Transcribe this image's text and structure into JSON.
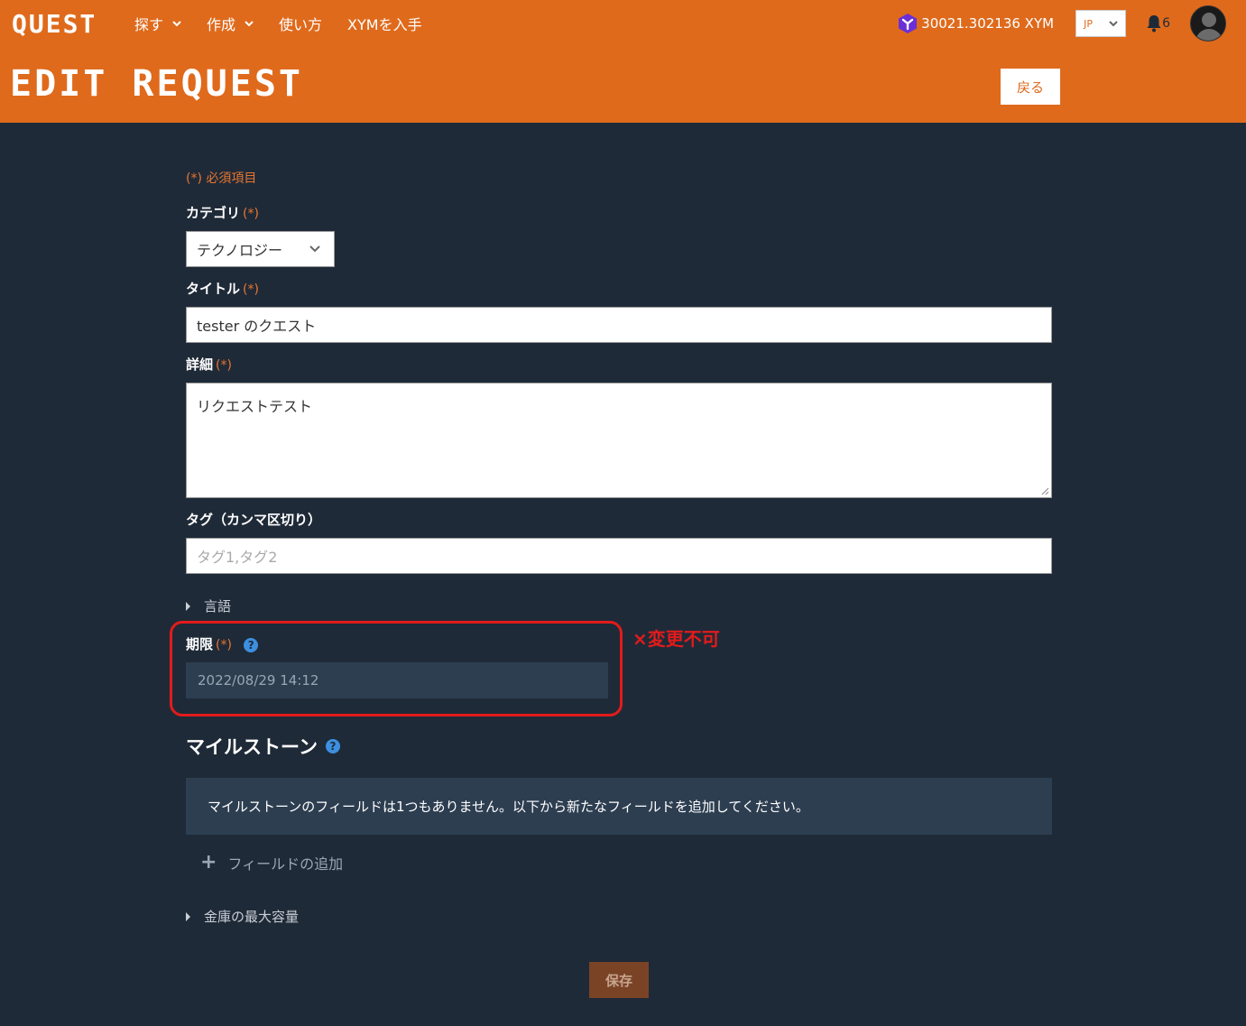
{
  "header": {
    "logo": "QUEST",
    "nav": [
      {
        "label": "探す",
        "has_dropdown": true
      },
      {
        "label": "作成",
        "has_dropdown": true
      },
      {
        "label": "使い方",
        "has_dropdown": false
      },
      {
        "label": "XYMを入手",
        "has_dropdown": false
      }
    ],
    "balance": "30021.302136 XYM",
    "language": "JP",
    "notifications_count": "6",
    "page_title": "EDIT REQUEST",
    "back_label": "戻る"
  },
  "form": {
    "required_note": "(*) 必須項目",
    "required_mark": "(*)",
    "category": {
      "label": "カテゴリ",
      "value": "テクノロジー"
    },
    "title": {
      "label": "タイトル",
      "value": "tester のクエスト"
    },
    "details": {
      "label": "詳細",
      "value": "リクエストテスト"
    },
    "tags": {
      "label": "タグ（カンマ区切り）",
      "placeholder": "タグ1,タグ2",
      "value": ""
    },
    "language_toggle": "言語",
    "deadline": {
      "label": "期限",
      "value": "2022/08/29 14:12"
    },
    "milestones": {
      "title": "マイルストーン",
      "empty_message": "マイルストーンのフィールドは1つもありません。以下から新たなフィールドを追加してください。",
      "add_label": "フィールドの追加"
    },
    "vault_toggle": "金庫の最大容量",
    "save_label": "保存"
  },
  "annotation": {
    "text": "×変更不可",
    "color": "#e21b1b"
  },
  "colors": {
    "brand": "#df6a1c",
    "background": "#1f2a38",
    "panel": "#2d3e51",
    "help": "#3d8fe0"
  }
}
